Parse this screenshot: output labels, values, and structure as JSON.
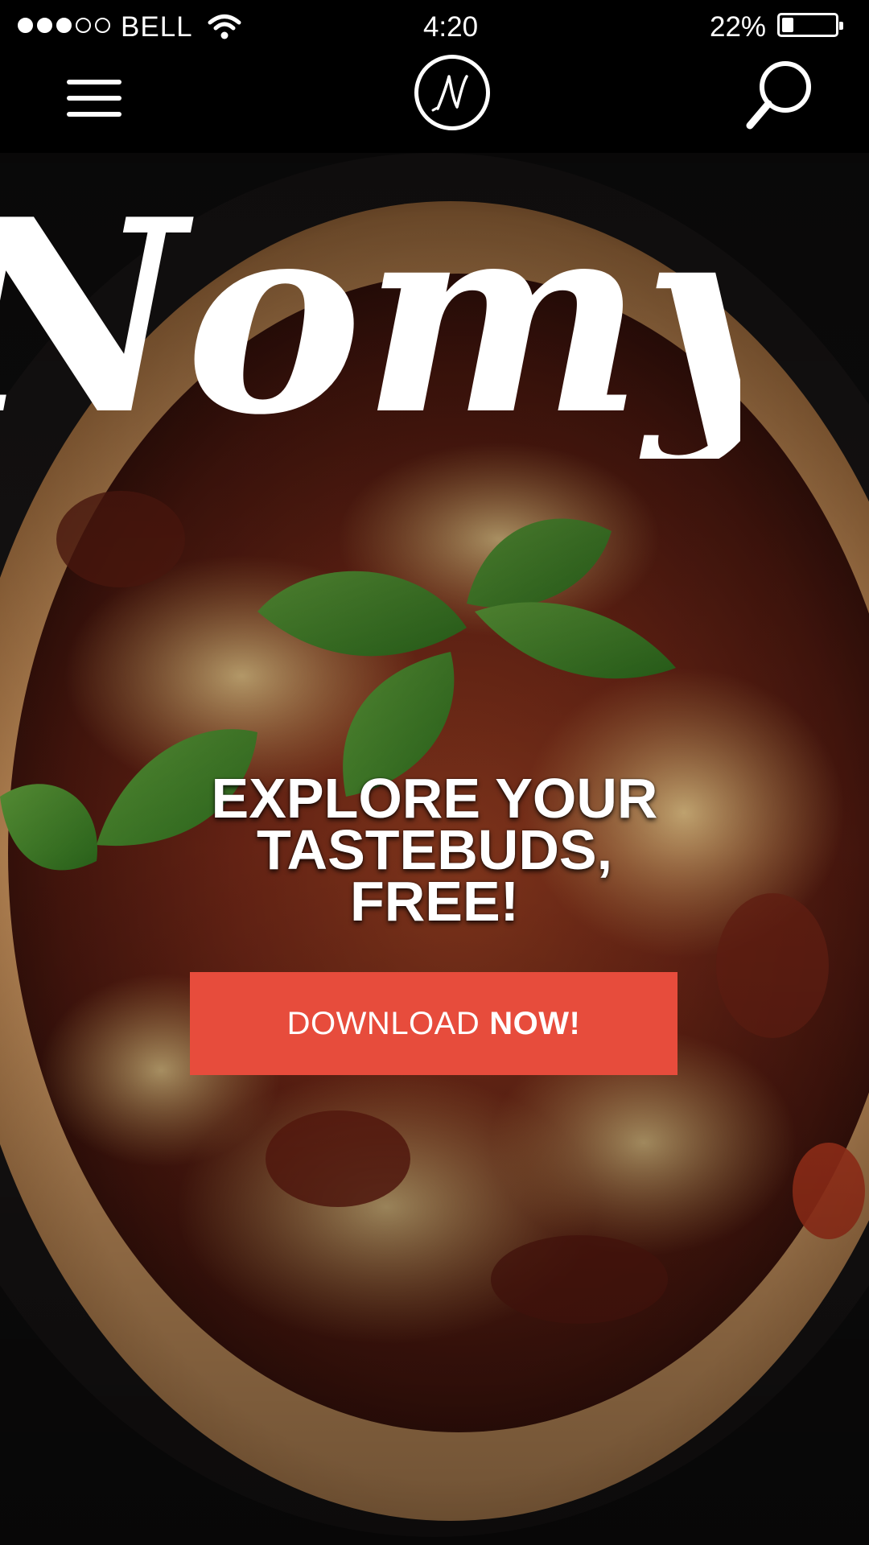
{
  "status_bar": {
    "carrier": "BELL",
    "time": "4:20",
    "battery_percent": "22%",
    "battery_level": 0.22,
    "signal_bars_total": 5,
    "signal_bars_filled": 3
  },
  "nav": {
    "menu_icon": "hamburger-menu-icon",
    "logo_icon": "nomy-logo-icon",
    "search_icon": "search-icon"
  },
  "hero": {
    "brand": "Nomy",
    "tagline": "EXPLORE YOUR\nTASTEBUDS,\nFREE!",
    "cta_light": "DOWNLOAD",
    "cta_bold": "NOW!"
  },
  "colors": {
    "background": "#000000",
    "cta": "#e74c3c",
    "text": "#ffffff"
  }
}
